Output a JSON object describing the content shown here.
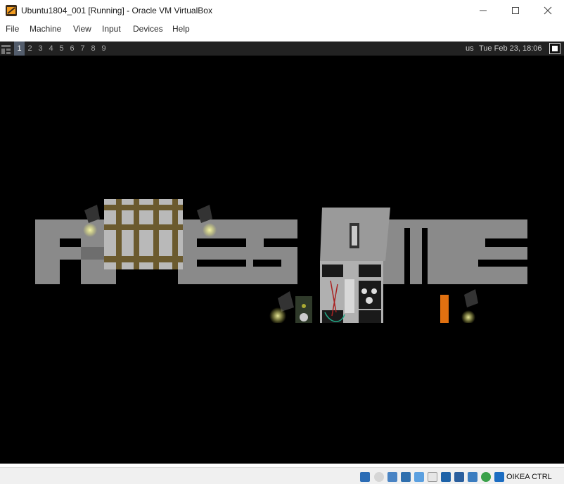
{
  "window": {
    "title": "Ubuntu1804_001 [Running] - Oracle VM VirtualBox",
    "icon": "virtualbox-icon",
    "controls": [
      "minimize-icon",
      "maximize-icon",
      "close-icon"
    ]
  },
  "menu": {
    "items": [
      "File",
      "Machine",
      "View",
      "Input",
      "Devices",
      "Help"
    ]
  },
  "guest": {
    "layout_icon": "tile-layout-icon",
    "tags": [
      {
        "label": "1",
        "active": true
      },
      {
        "label": "2",
        "active": false
      },
      {
        "label": "3",
        "active": false
      },
      {
        "label": "4",
        "active": false
      },
      {
        "label": "5",
        "active": false
      },
      {
        "label": "6",
        "active": false
      },
      {
        "label": "7",
        "active": false
      },
      {
        "label": "8",
        "active": false
      },
      {
        "label": "9",
        "active": false
      }
    ],
    "keyboard_layout": "us",
    "clock": "Tue Feb 23, 18:06",
    "wallpaper_text": "awesome"
  },
  "status": {
    "icons": [
      "hard-disk-icon",
      "optical-drive-icon",
      "audio-icon",
      "network-icon",
      "usb-icon",
      "shared-folders-icon",
      "display-icon",
      "video-capture-icon",
      "virtualization-icon",
      "mouse-integration-icon",
      "keyboard-capture-icon"
    ],
    "host_key": "OIKEA CTRL"
  }
}
